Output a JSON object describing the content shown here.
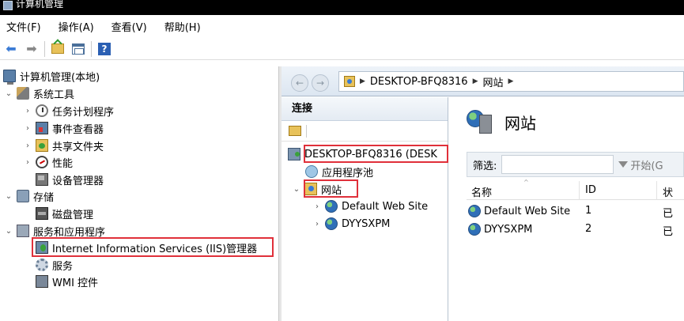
{
  "window": {
    "title": "计算机管理"
  },
  "menu": [
    {
      "label": "文件(F)"
    },
    {
      "label": "操作(A)"
    },
    {
      "label": "查看(V)"
    },
    {
      "label": "帮助(H)"
    }
  ],
  "toolbar": {
    "back_icon": "back-arrow-icon",
    "forward_icon": "forward-arrow-icon",
    "up_icon": "folder-up-icon",
    "view_icon": "console-tree-icon",
    "help_label": "?"
  },
  "tree": {
    "root": "计算机管理(本地)",
    "system_tools": "系统工具",
    "task_scheduler": "任务计划程序",
    "event_viewer": "事件查看器",
    "shared_folders": "共享文件夹",
    "performance": "性能",
    "device_manager": "设备管理器",
    "storage": "存储",
    "disk_management": "磁盘管理",
    "services_apps": "服务和应用程序",
    "iis_manager": "Internet Information Services (IIS)管理器",
    "services": "服务",
    "wmi": "WMI 控件"
  },
  "iis": {
    "breadcrumbs": [
      "DESKTOP-BFQ8316",
      "网站"
    ],
    "connections": {
      "header": "连接",
      "server": "DESKTOP-BFQ8316 (DESK",
      "app_pools": "应用程序池",
      "sites": "网站",
      "site_items": [
        "Default Web Site",
        "DYYSXPM"
      ]
    },
    "main": {
      "title": "网站",
      "filter_label": "筛选:",
      "filter_value": "",
      "start_label": "开始(G",
      "columns": [
        "名称",
        "ID",
        "状"
      ],
      "rows": [
        {
          "name": "Default Web Site",
          "id": "1",
          "status": "已"
        },
        {
          "name": "DYYSXPM",
          "id": "2",
          "status": "已"
        }
      ]
    }
  },
  "colors": {
    "highlight_box": "#e0303a",
    "accent": "#3a7bd5"
  }
}
